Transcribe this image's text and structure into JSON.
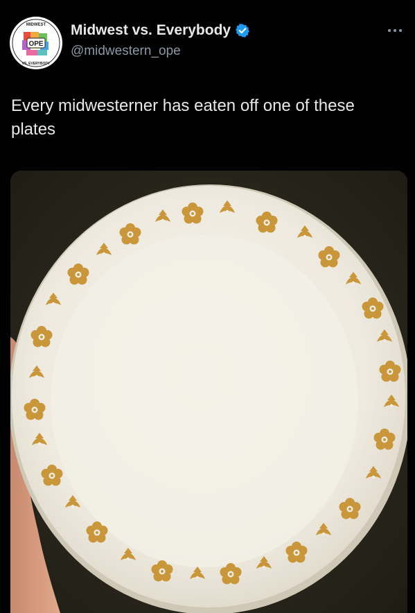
{
  "tweet": {
    "display_name": "Midwest vs. Everybody",
    "handle": "@midwestern_ope",
    "text": "Every midwesterner has eaten off one of these plates",
    "verified": true,
    "more_icon": "more-horizontal-icon"
  },
  "avatar": {
    "top_text": "MIDWEST",
    "center_text": "OPE",
    "bottom_text": "VS. EVERYBODY"
  },
  "media": {
    "description_icon": "photo"
  },
  "colors": {
    "background": "#000000",
    "text_primary": "#e7e9ea",
    "text_secondary": "#8b98a5",
    "verified_blue": "#1d9bf0",
    "plate": "#f1ede2",
    "plate_pattern": "#c9963a"
  }
}
